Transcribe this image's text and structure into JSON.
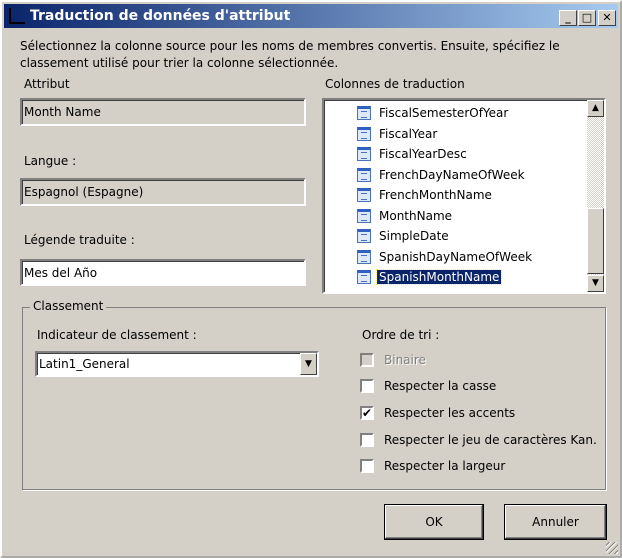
{
  "window": {
    "title": "Traduction de données d'attribut",
    "minimize": "_",
    "maximize": "□",
    "close": "✕"
  },
  "intro": "Sélectionnez la colonne source pour les noms de membres convertis. Ensuite, spécifiez le classement utilisé pour trier la colonne sélectionnée.",
  "attribute": {
    "label": "Attribut",
    "value": "Month Name"
  },
  "language": {
    "label": "Langue :",
    "value": "Espagnol (Espagne)"
  },
  "caption": {
    "label": "Légende traduite :",
    "value": "Mes del Año"
  },
  "columns": {
    "label": "Colonnes de traduction",
    "items": [
      "FiscalSemesterOfYear",
      "FiscalYear",
      "FiscalYearDesc",
      "FrenchDayNameOfWeek",
      "FrenchMonthName",
      "MonthName",
      "SimpleDate",
      "SpanishDayNameOfWeek",
      "SpanishMonthName"
    ],
    "selected": "SpanishMonthName"
  },
  "collation": {
    "group_label": "Classement",
    "indicator_label": "Indicateur de classement :",
    "indicator_value": "Latin1_General",
    "sort_label": "Ordre de tri :",
    "options": [
      {
        "label": "Binaire",
        "checked": false,
        "disabled": true
      },
      {
        "label": "Respecter la casse",
        "checked": false
      },
      {
        "label": "Respecter les accents",
        "checked": true
      },
      {
        "label": "Respecter le jeu de caractères Kan.",
        "checked": false
      },
      {
        "label": "Respecter la largeur",
        "checked": false
      }
    ]
  },
  "buttons": {
    "ok": "OK",
    "cancel": "Annuler"
  }
}
